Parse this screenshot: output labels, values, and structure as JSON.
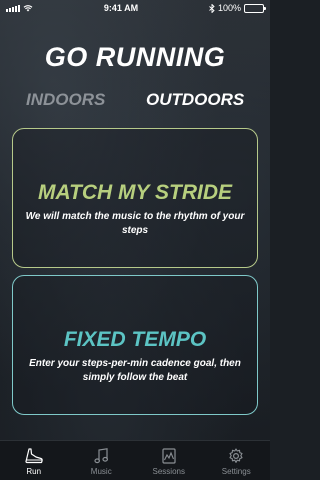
{
  "status": {
    "time": "9:41 AM",
    "battery": "100%",
    "battery_level": 1.0
  },
  "title": "GO RUNNING",
  "tabs": [
    {
      "label": "INDOORS",
      "active": false
    },
    {
      "label": "OUTDOORS",
      "active": true
    }
  ],
  "cards": {
    "stride": {
      "title": "MATCH MY STRIDE",
      "description": "We will match the music to the rhythm of your steps",
      "color": "#b7cf7e"
    },
    "tempo": {
      "title": "FIXED TEMPO",
      "description": "Enter your steps-per-min cadence goal, then simply follow the beat",
      "color": "#5cc4c4"
    }
  },
  "tabbar": [
    {
      "label": "Run",
      "icon": "shoe-icon",
      "active": true
    },
    {
      "label": "Music",
      "icon": "music-note-icon",
      "active": false
    },
    {
      "label": "Sessions",
      "icon": "sessions-icon",
      "active": false
    },
    {
      "label": "Settings",
      "icon": "gear-icon",
      "active": false
    }
  ]
}
